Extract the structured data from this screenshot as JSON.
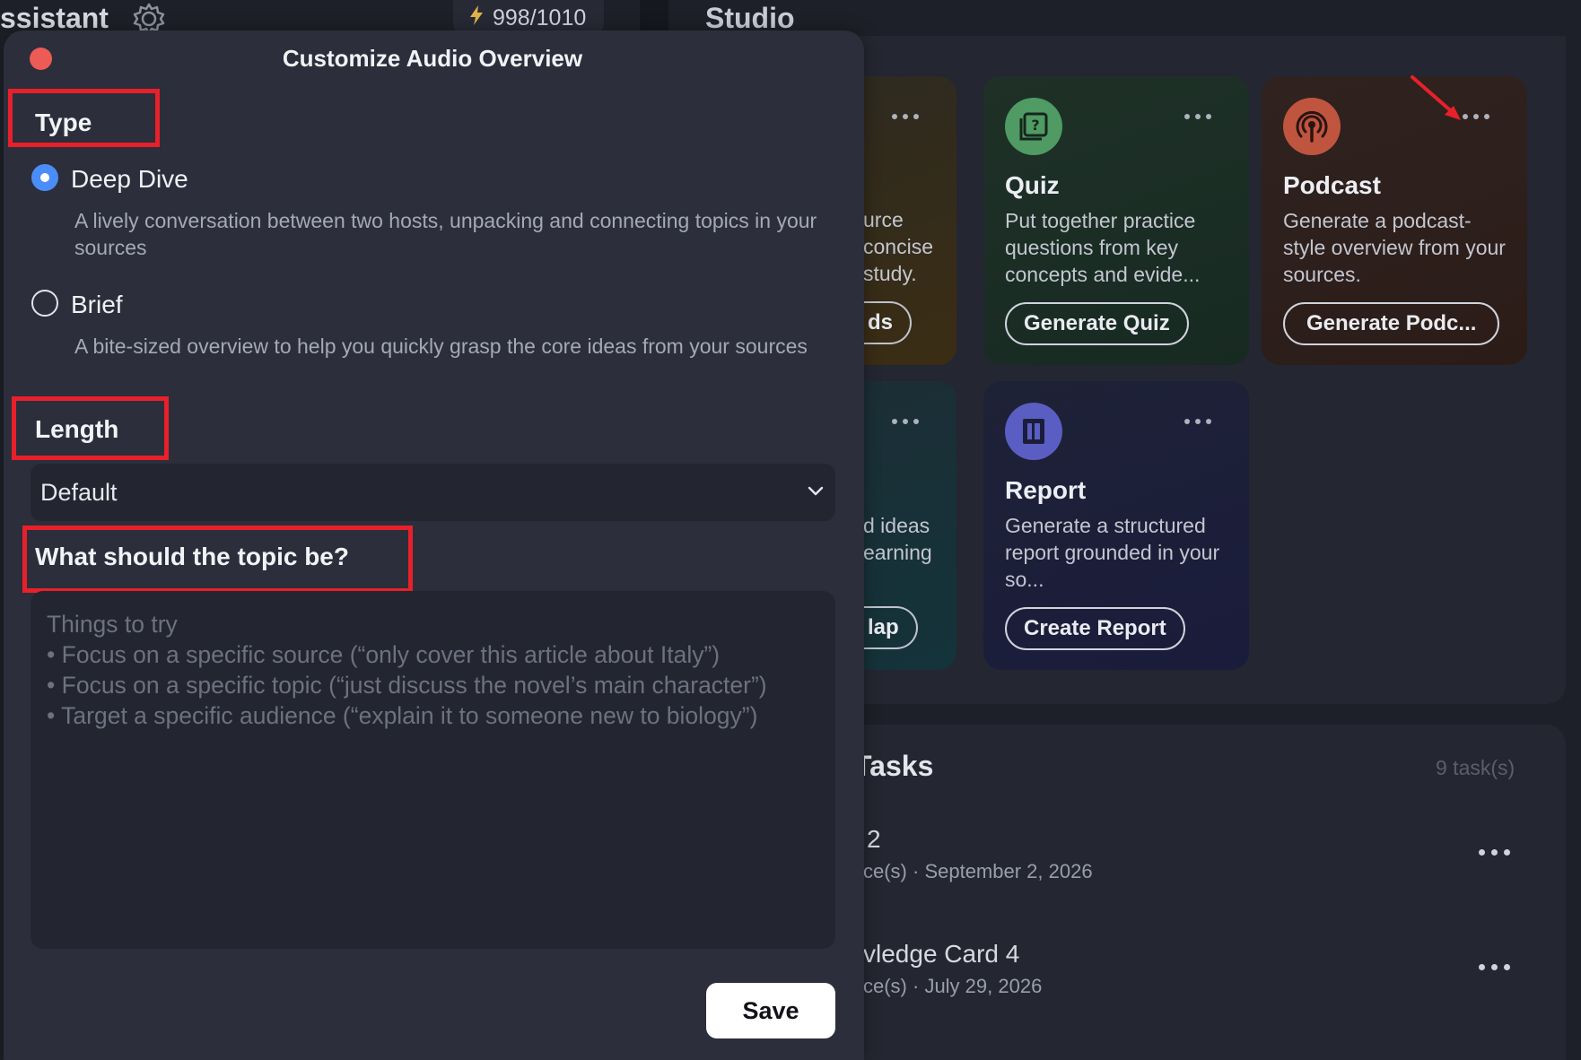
{
  "app": {
    "panel_title_left": "ssistant",
    "credits": "998/1010",
    "studio_title": "Studio"
  },
  "modal": {
    "title": "Customize Audio Overview",
    "type_label": "Type",
    "options": [
      {
        "label": "Deep Dive",
        "desc": "A lively conversation between two hosts, unpacking and connecting topics in your sources",
        "selected": true
      },
      {
        "label": "Brief",
        "desc": "A bite-sized overview to help you quickly grasp the core ideas from your sources",
        "selected": false
      }
    ],
    "length_label": "Length",
    "length_value": "Default",
    "topic_label": "What should the topic be?",
    "topic_placeholder": "Things to try\n• Focus on a specific source (“only cover this article about Italy”)\n• Focus on a specific topic (“just discuss the novel’s main character”)\n• Target a specific audience (“explain it to someone new to biology”)",
    "save_label": "Save"
  },
  "cards": {
    "flash": {
      "desc_partial": "urce\nconcise\n study.",
      "button_partial": "ds"
    },
    "quiz": {
      "title": "Quiz",
      "desc": "Put together practice questions from key concepts and evide...",
      "button": "Generate Quiz"
    },
    "podcast": {
      "title": "Podcast",
      "desc": "Generate a podcast-style overview from your sources.",
      "button": "Generate Podc..."
    },
    "mind": {
      "desc_partial": "d ideas\nearning",
      "button_partial": "lap"
    },
    "report": {
      "title": "Report",
      "desc": "Generate a structured report grounded in your so...",
      "button": "Create Report"
    }
  },
  "tasks": {
    "title": "Tasks",
    "count": "9 task(s)",
    "items": [
      {
        "title": "2",
        "meta": "ce(s) · September 2, 2026"
      },
      {
        "title": "vledge Card 4",
        "meta": "ce(s) · July 29, 2026"
      }
    ]
  },
  "colors": {
    "accent_radio": "#4b8df8",
    "close_dot": "#ec5b55",
    "annotation_red": "#e8202a"
  }
}
